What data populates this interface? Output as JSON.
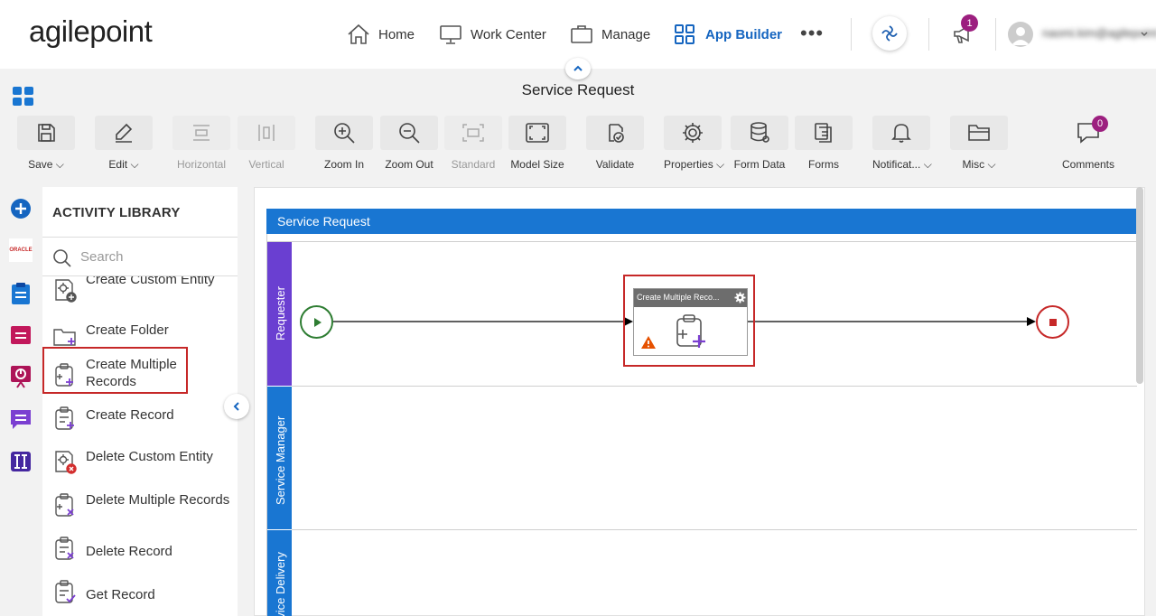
{
  "header": {
    "logo": "agilepoint",
    "nav": [
      {
        "label": "Home",
        "icon": "home-icon"
      },
      {
        "label": "Work Center",
        "icon": "monitor-icon"
      },
      {
        "label": "Manage",
        "icon": "briefcase-icon"
      },
      {
        "label": "App Builder",
        "icon": "apps-grid-icon",
        "active": true
      }
    ],
    "more": "•••",
    "notifications_count": "1",
    "user_name": "naomi.kim@agilepoint",
    "accent_color": "#1565c0",
    "badge_color": "#9c1f7f"
  },
  "page": {
    "title": "Service Request"
  },
  "toolbar": [
    {
      "label": "Save",
      "icon": "save-icon",
      "dropdown": true
    },
    {
      "label": "Edit",
      "icon": "pencil-icon",
      "dropdown": true
    },
    {
      "label": "Horizontal",
      "icon": "horizontal-align-icon",
      "disabled": true
    },
    {
      "label": "Vertical",
      "icon": "vertical-align-icon",
      "disabled": true
    },
    {
      "label": "Zoom In",
      "icon": "zoom-in-icon"
    },
    {
      "label": "Zoom Out",
      "icon": "zoom-out-icon"
    },
    {
      "label": "Standard",
      "icon": "standard-size-icon",
      "disabled": true
    },
    {
      "label": "Model Size",
      "icon": "model-size-icon"
    },
    {
      "label": "Validate",
      "icon": "validate-icon"
    },
    {
      "label": "Properties",
      "icon": "gear-icon",
      "dropdown": true
    },
    {
      "label": "Form Data",
      "icon": "database-icon"
    },
    {
      "label": "Forms",
      "icon": "forms-icon"
    },
    {
      "label": "Notificat...",
      "icon": "bell-icon",
      "dropdown": true
    },
    {
      "label": "Misc",
      "icon": "folder-icon",
      "dropdown": true
    },
    {
      "label": "Comments",
      "icon": "comment-icon"
    }
  ],
  "comments_count": "0",
  "library": {
    "title": "ACTIVITY LIBRARY",
    "search_placeholder": "Search",
    "items": [
      {
        "label": "Create Custom Entity"
      },
      {
        "label": "Create Folder"
      },
      {
        "label": "Create Multiple Records",
        "selected": true
      },
      {
        "label": "Create Record"
      },
      {
        "label": "Delete Custom Entity"
      },
      {
        "label": "Delete Multiple Records"
      },
      {
        "label": "Delete Record"
      },
      {
        "label": "Get Record"
      }
    ]
  },
  "rail": {
    "oracle_label": "ORACLE"
  },
  "diagram": {
    "pool": "Service Request",
    "lanes": [
      "Requester",
      "Service Manager",
      "Service Delivery"
    ],
    "task_title": "Create Multiple Reco...",
    "lane_color": "#6a3fd1",
    "pool_color": "#1976d2"
  }
}
